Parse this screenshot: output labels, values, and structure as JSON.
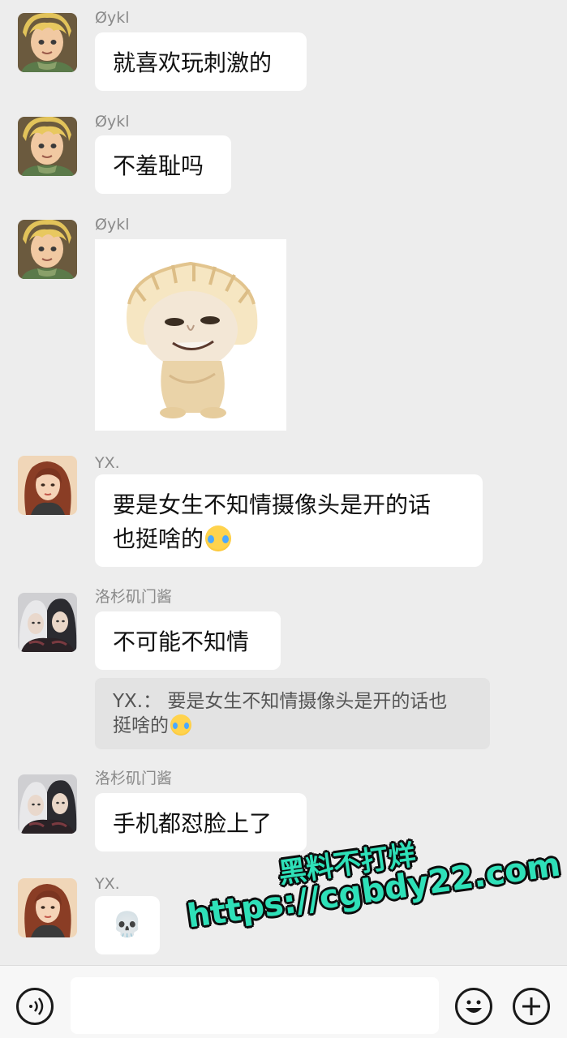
{
  "messages": [
    {
      "sender": "Øykl",
      "text": "就喜欢玩刺激的"
    },
    {
      "sender": "Øykl",
      "text": "不羞耻吗"
    },
    {
      "sender": "Øykl",
      "sticker": "dumpling-face-sticker"
    },
    {
      "sender": "YX.",
      "line1": "要是女生不知情摄像头是开的话",
      "line2": "也挺啥的"
    },
    {
      "sender": "洛杉矶门酱",
      "text": "不可能不知情",
      "quote": {
        "line1": "YX.： 要是女生不知情摄像头是开的话也",
        "line2": "挺啥的"
      }
    },
    {
      "sender": "洛杉矶门酱",
      "text": "手机都怼脸上了"
    },
    {
      "sender": "YX.",
      "text": "💀"
    }
  ],
  "watermark": {
    "line1": "黑料不打烊",
    "line2": "https://cgbdy22.com"
  },
  "input_bar": {
    "voice_icon": "voice-icon",
    "emoji_icon": "emoji-icon",
    "plus_icon": "plus-icon"
  },
  "colors": {
    "background": "#ededed",
    "bubble": "#ffffff",
    "quote": "#e3e3e3",
    "watermark": "#2ee0b8"
  }
}
